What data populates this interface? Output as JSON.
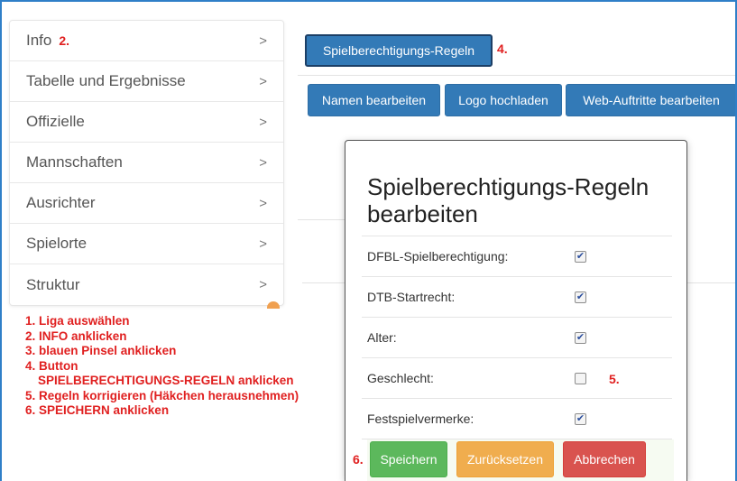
{
  "sidebar": {
    "items": [
      {
        "label": "Info",
        "mark": "2."
      },
      {
        "label": "Tabelle und Ergebnisse",
        "mark": ""
      },
      {
        "label": "Offizielle",
        "mark": ""
      },
      {
        "label": "Mannschaften",
        "mark": ""
      },
      {
        "label": "Ausrichter",
        "mark": ""
      },
      {
        "label": "Spielorte",
        "mark": ""
      },
      {
        "label": "Struktur",
        "mark": ""
      }
    ],
    "chevron": ">"
  },
  "toolbar": {
    "rules_button": "Spielberechtigungs-Regeln",
    "rules_mark": "4.",
    "edit_name_button": "Namen bearbeiten",
    "upload_logo_button": "Logo hochladen",
    "edit_web_button": "Web-Auftritte bearbeiten"
  },
  "modal": {
    "title": "Spielberechtigungs-Regeln bearbeiten",
    "rows": [
      {
        "label": "DFBL-Spielberechtigung:",
        "checked": true,
        "mark": ""
      },
      {
        "label": "DTB-Startrecht:",
        "checked": true,
        "mark": ""
      },
      {
        "label": "Alter:",
        "checked": true,
        "mark": ""
      },
      {
        "label": "Geschlecht:",
        "checked": false,
        "mark": "5."
      },
      {
        "label": "Festspielvermerke:",
        "checked": true,
        "mark": ""
      }
    ],
    "save_mark": "6.",
    "save_button": "Speichern",
    "reset_button": "Zurücksetzen",
    "cancel_button": "Abbrechen"
  },
  "instructions": [
    "1. Liga auswählen",
    "2. INFO anklicken",
    "3. blauen Pinsel anklicken",
    "4. Button",
    "SPIELBERECHTIGUNGS-REGELN anklicken",
    "5. Regeln korrigieren (Häkchen herausnehmen)",
    "6. SPEICHERN anklicken"
  ],
  "colors": {
    "frame": "#2f7fc8",
    "primary": "#337ab7",
    "success": "#5cb85c",
    "warning": "#f0ad4e",
    "danger": "#d9534f",
    "annotation": "#e02020"
  }
}
